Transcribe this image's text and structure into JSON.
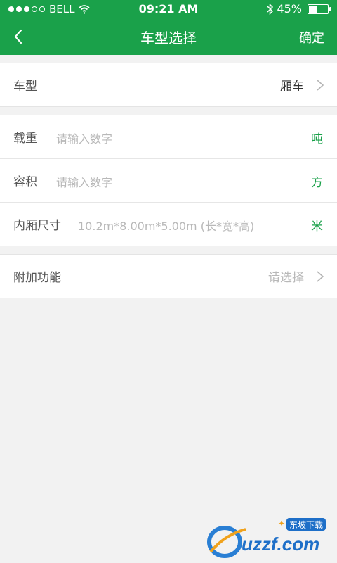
{
  "status": {
    "carrier": "BELL",
    "time": "09:21 AM",
    "battery": "45%",
    "battery_level": 0.45
  },
  "nav": {
    "title": "车型选择",
    "confirm": "确定"
  },
  "vehicle_type": {
    "label": "车型",
    "value": "厢车"
  },
  "specs": {
    "load": {
      "label": "载重",
      "placeholder": "请输入数字",
      "unit": "吨"
    },
    "volume": {
      "label": "容积",
      "placeholder": "请输入数字",
      "unit": "方"
    },
    "dimensions": {
      "label": "内厢尺寸",
      "placeholder": "10.2m*8.00m*5.00m (长*宽*高)",
      "unit": "米"
    }
  },
  "extras": {
    "label": "附加功能",
    "value": "请选择"
  },
  "watermark": {
    "brand": "uzzf.com",
    "tag": "东坡下载"
  },
  "colors": {
    "accent": "#1aa14a"
  }
}
